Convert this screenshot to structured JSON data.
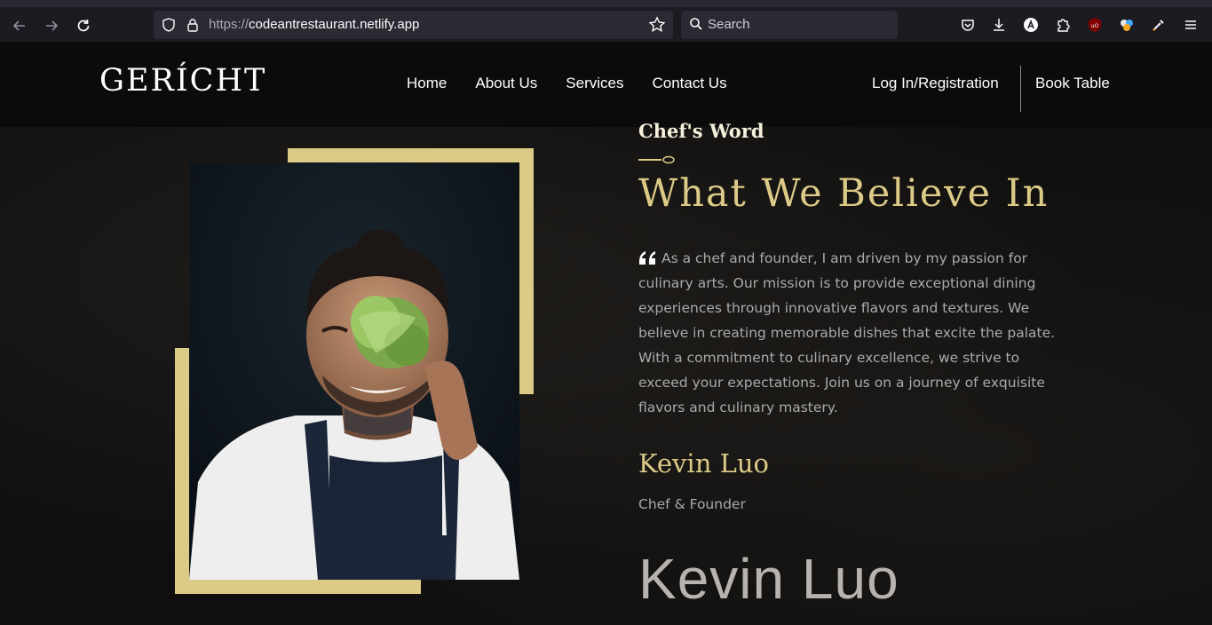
{
  "browser": {
    "url_protocol": "https://",
    "url_host": "codeantrestaurant.netlify.app",
    "search_placeholder": "Search"
  },
  "site": {
    "logo": "GERÍCHT",
    "nav": [
      "Home",
      "About Us",
      "Services",
      "Contact Us"
    ],
    "login_label": "Log In/Registration",
    "book_label": "Book Table"
  },
  "chef": {
    "subtitle": "Chef's Word",
    "headline": "What We Believe In",
    "quote": "As a chef and founder, I am driven by my passion for culinary arts. Our mission is to provide exceptional dining experiences through innovative flavors and textures. We believe in creating memorable dishes that excite the palate. With a commitment to culinary excellence, we strive to exceed your expectations. Join us on a journey of exquisite flavors and culinary mastery.",
    "name": "Kevin Luo",
    "role": "Chef & Founder",
    "signature": "Kevin Luo"
  },
  "colors": {
    "accent_gold": "#dcca87",
    "background": "#0c0c0c",
    "text_gray": "#aaaaaa"
  }
}
